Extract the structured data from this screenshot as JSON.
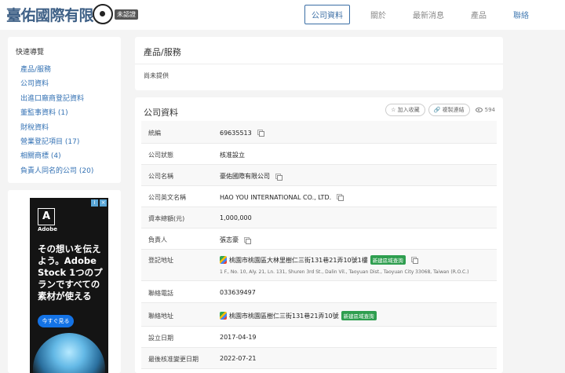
{
  "header": {
    "logo_text": "臺佑國際有限公司",
    "logo_badge": "未認證",
    "nav": [
      "公司資料",
      "關於",
      "最新消息",
      "產品",
      "聯絡"
    ]
  },
  "sidebar": {
    "title": "快速導覽",
    "items": [
      "產品/服務",
      "公司資料",
      "出進口廠商登記資料",
      "董監事資料 (1)",
      "財稅資料",
      "營業登記項目 (17)",
      "相關商標 (4)",
      "負責人同名的公司 (20)"
    ]
  },
  "ad": {
    "brand": "Adobe",
    "copy": "その想いを伝えよう。Adobe Stock 1つのプランですべての素材が使える",
    "cta": "今すぐ見る",
    "adchoice": [
      "i",
      "×"
    ]
  },
  "products_card": {
    "title": "產品/服務",
    "body": "尚未提供"
  },
  "company_card": {
    "title": "公司資料",
    "follow_label": "☆ 加入收藏",
    "link_label": "複製連結",
    "views": "594",
    "add_business_label": "新建區域查詢",
    "rows": [
      {
        "label": "統編",
        "value": "69635513"
      },
      {
        "label": "公司狀態",
        "value": "核准設立"
      },
      {
        "label": "公司名稱",
        "value": "豪佑國際有限公司"
      },
      {
        "label": "公司英文名稱",
        "value": "HAO YOU INTERNATIONAL CO., LTD."
      },
      {
        "label": "資本總額(元)",
        "value": "1,000,000"
      },
      {
        "label": "負責人",
        "value": "張志豪"
      },
      {
        "label": "登記地址",
        "value": "桃園市桃園區大林里樹仁三街131巷21弄10號1樓",
        "sub": "1 F., No. 10, Aly. 21, Ln. 131, Shuren 3rd St., Dalin Vil., Taoyuan Dist., Taoyuan City 33068, Taiwan (R.O.C.)"
      },
      {
        "label": "聯絡電話",
        "value": "033639497"
      },
      {
        "label": "聯絡地址",
        "value": "桃園市桃園區樹仁三街131巷21弄10號"
      },
      {
        "label": "設立日期",
        "value": "2017-04-19"
      },
      {
        "label": "最後核准變更日期",
        "value": "2022-07-21"
      }
    ]
  }
}
